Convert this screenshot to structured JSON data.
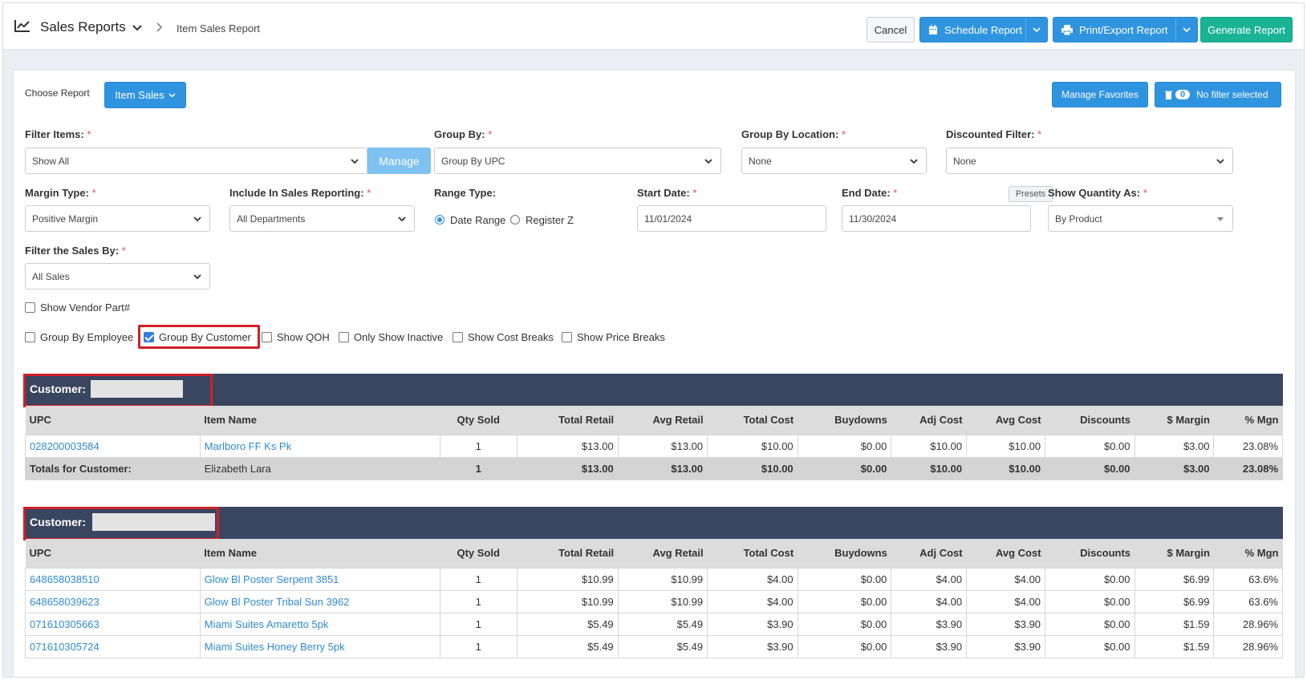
{
  "header": {
    "title": "Sales Reports",
    "breadcrumb": "Item Sales Report",
    "buttons": {
      "cancel": "Cancel",
      "schedule": "Schedule Report",
      "print": "Print/Export Report",
      "generate": "Generate Report"
    }
  },
  "report_picker": {
    "label": "Choose Report",
    "selected": "Item Sales",
    "manage_favorites": "Manage Favorites",
    "filter_count": "0",
    "filter_status": "No filter selected"
  },
  "filters": {
    "filter_items": {
      "label": "Filter Items:",
      "value": "Show All",
      "manage": "Manage"
    },
    "group_by": {
      "label": "Group By:",
      "value": "Group By UPC"
    },
    "group_by_location": {
      "label": "Group By Location:",
      "value": "None"
    },
    "discounted_filter": {
      "label": "Discounted Filter:",
      "value": "None"
    },
    "margin_type": {
      "label": "Margin Type:",
      "value": "Positive Margin"
    },
    "include_in_sales": {
      "label": "Include In Sales Reporting:",
      "value": "All Departments"
    },
    "range_type": {
      "label": "Range Type:",
      "option_date": "Date Range",
      "option_register": "Register Z"
    },
    "start_date": {
      "label": "Start Date:",
      "value": "11/01/2024"
    },
    "end_date": {
      "label": "End Date:",
      "value": "11/30/2024",
      "presets": "Presets"
    },
    "show_quantity": {
      "label": "Show Quantity As:",
      "value": "By Product"
    },
    "filter_sales_by": {
      "label": "Filter the Sales By:",
      "value": "All Sales"
    },
    "required_mark": "*"
  },
  "options": {
    "show_vendor_part": "Show Vendor Part#",
    "group_by_employee": "Group By Employee",
    "group_by_customer": "Group By Customer",
    "show_qoh": "Show QOH",
    "only_show_inactive": "Only Show Inactive",
    "show_cost_breaks": "Show Cost Breaks",
    "show_price_breaks": "Show Price Breaks"
  },
  "table_columns": [
    "UPC",
    "Item Name",
    "Qty Sold",
    "Total Retail",
    "Avg Retail",
    "Total Cost",
    "Buydowns",
    "Adj Cost",
    "Avg Cost",
    "Discounts",
    "$ Margin",
    "% Mgn"
  ],
  "customer_label": "Customer:",
  "groups": [
    {
      "rows": [
        [
          "028200003584",
          "Marlboro FF Ks Pk",
          "1",
          "$13.00",
          "$13.00",
          "$10.00",
          "$0.00",
          "$10.00",
          "$10.00",
          "$0.00",
          "$3.00",
          "23.08%"
        ]
      ],
      "totals": [
        "Totals for Customer:",
        "Elizabeth Lara",
        "1",
        "$13.00",
        "$13.00",
        "$10.00",
        "$0.00",
        "$10.00",
        "$10.00",
        "$0.00",
        "$3.00",
        "23.08%"
      ]
    },
    {
      "rows": [
        [
          "648658038510",
          "Glow Bl Poster Serpent 3851",
          "1",
          "$10.99",
          "$10.99",
          "$4.00",
          "$0.00",
          "$4.00",
          "$4.00",
          "$0.00",
          "$6.99",
          "63.6%"
        ],
        [
          "648658039623",
          "Glow Bl Poster Tribal Sun 3962",
          "1",
          "$10.99",
          "$10.99",
          "$4.00",
          "$0.00",
          "$4.00",
          "$4.00",
          "$0.00",
          "$6.99",
          "63.6%"
        ],
        [
          "071610305663",
          "Miami Suites Amaretto 5pk",
          "1",
          "$5.49",
          "$5.49",
          "$3.90",
          "$0.00",
          "$3.90",
          "$3.90",
          "$0.00",
          "$1.59",
          "28.96%"
        ],
        [
          "071610305724",
          "Miami Suites Honey Berry 5pk",
          "1",
          "$5.49",
          "$5.49",
          "$3.90",
          "$0.00",
          "$3.90",
          "$3.90",
          "$0.00",
          "$1.59",
          "28.96%"
        ]
      ]
    }
  ],
  "colors": {
    "primary": "#2f94e0",
    "success": "#1ab394",
    "customer_bar": "#3a4560",
    "highlight": "#d0202a",
    "link": "#2f8ad0"
  }
}
